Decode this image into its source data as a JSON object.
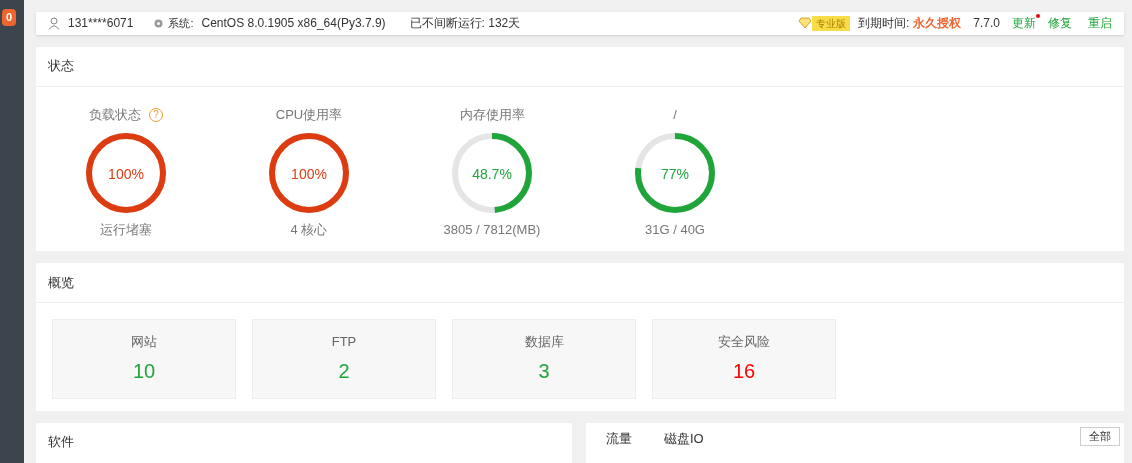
{
  "sidebar": {
    "badge": "0"
  },
  "header": {
    "user": "131****6071",
    "system_label": "系统:",
    "system": "CentOS 8.0.1905 x86_64(Py3.7.9)",
    "uptime": "已不间断运行: 132天",
    "edition": "专业版",
    "expiry_label": "到期时间:",
    "expiry": "永久授权",
    "version": "7.7.0",
    "update": "更新",
    "update_dot": true,
    "repair": "修复",
    "restart": "重启"
  },
  "status": {
    "title": "状态",
    "gauges": [
      {
        "label": "负载状态",
        "help": "?",
        "level": 1,
        "reading": "100%",
        "caption": "运行堵塞"
      },
      {
        "label": "CPU使用率",
        "level": 1,
        "reading": "100%",
        "caption": "4 核心"
      },
      {
        "label": "内存使用率",
        "level": 0.487,
        "reading": "48.7%",
        "caption": "3805 / 7812(MB)"
      },
      {
        "label": "/",
        "level": 0.77,
        "reading": "77%",
        "caption": "31G / 40G"
      }
    ]
  },
  "overview": {
    "title": "概览",
    "cards": [
      {
        "label": "网站",
        "count": "10",
        "alert": false
      },
      {
        "label": "FTP",
        "count": "2",
        "alert": false
      },
      {
        "label": "数据库",
        "count": "3",
        "alert": false
      },
      {
        "label": "安全风险",
        "count": "16",
        "alert": true
      }
    ]
  },
  "bottom": {
    "left_title": "软件",
    "right_tabs": [
      "流量",
      "磁盘IO"
    ],
    "select": "全部"
  }
}
